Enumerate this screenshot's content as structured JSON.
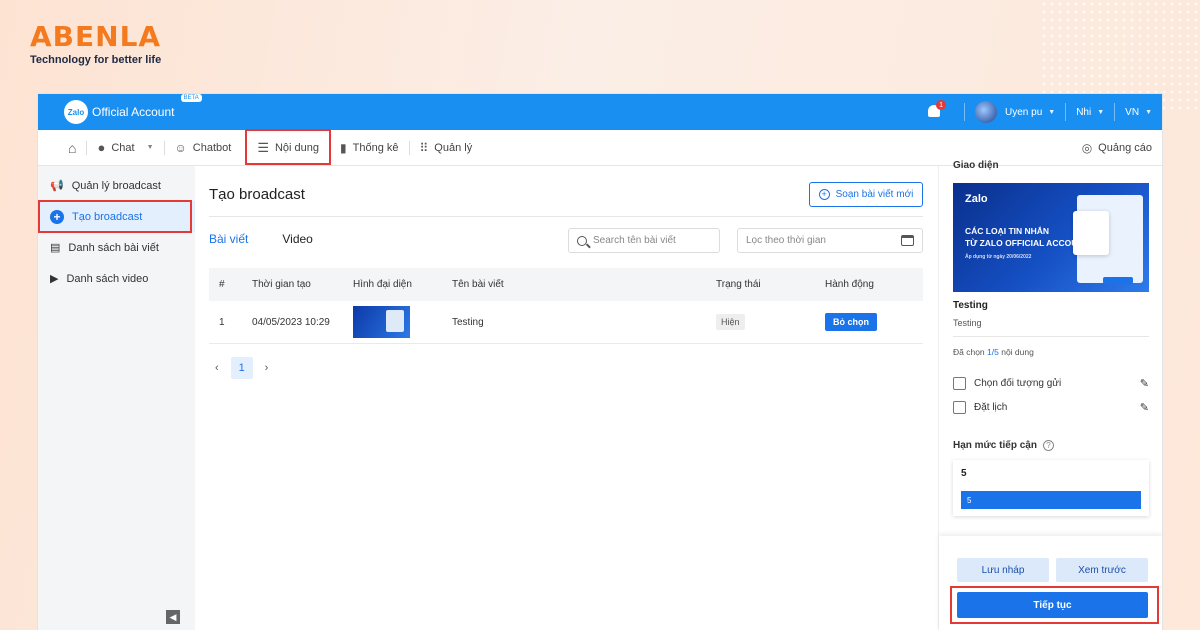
{
  "brand": {
    "name": "ABENLA",
    "tagline": "Technology for better life",
    "color": "#f47a20"
  },
  "topbar": {
    "logo_mark": "Zalo",
    "logo_text": "Official Account",
    "beta": "BETA",
    "notification_count": "1",
    "user_name": "Uyen pu",
    "account_switch": "Nhi",
    "language": "VN",
    "accent": "#1a8ff2"
  },
  "nav": {
    "items": [
      {
        "label": "Chat",
        "icon": "chat-bubble-icon"
      },
      {
        "label": "Chatbot",
        "icon": "robot-icon"
      },
      {
        "label": "Nội dung",
        "icon": "list-icon"
      },
      {
        "label": "Thống kê",
        "icon": "bar-chart-icon"
      },
      {
        "label": "Quản lý",
        "icon": "grid-icon"
      }
    ],
    "ads": "Quảng cáo"
  },
  "sidebar": {
    "items": [
      {
        "label": "Quản lý broadcast",
        "icon": "megaphone-icon"
      },
      {
        "label": "Tạo broadcast",
        "icon": "plus-circle-icon"
      },
      {
        "label": "Danh sách bài viết",
        "icon": "article-icon"
      },
      {
        "label": "Danh sách video",
        "icon": "video-icon"
      }
    ]
  },
  "main": {
    "title": "Tạo broadcast",
    "compose_label": "Soạn bài viết mới",
    "tabs": [
      "Bài viết",
      "Video"
    ],
    "search_placeholder": "Search tên bài viết",
    "date_placeholder": "Lọc theo thời gian",
    "table": {
      "headers": [
        "#",
        "Thời gian tạo",
        "Hình đại diện",
        "Tên bài viết",
        "Trạng thái",
        "Hành động"
      ],
      "rows": [
        {
          "index": "1",
          "created": "04/05/2023 10:29",
          "title": "Testing",
          "status": "Hiện",
          "action": "Bỏ chọn"
        }
      ]
    },
    "pagination": {
      "current": "1"
    }
  },
  "right_panel": {
    "heading": "Giao diện",
    "preview": {
      "logo": "Zalo",
      "title_line1": "CÁC LOẠI TIN NHẮN",
      "title_line2": "TỪ ZALO OFFICIAL ACCOUNT",
      "subtitle": "Áp dụng từ ngày 20/06/2022"
    },
    "article_title": "Testing",
    "article_desc": "Testing",
    "selected_prefix": "Đã chọn ",
    "selected_count": "1",
    "selected_total": "/5",
    "selected_suffix": " nội dung",
    "options": [
      {
        "label": "Chọn đối tượng gửi"
      },
      {
        "label": "Đặt lịch"
      }
    ],
    "limit_label": "Hạn mức tiếp cận",
    "limit_value": "5",
    "limit_bar_value": "5",
    "save_draft": "Lưu nháp",
    "preview_btn": "Xem trước",
    "continue": "Tiếp tục"
  }
}
